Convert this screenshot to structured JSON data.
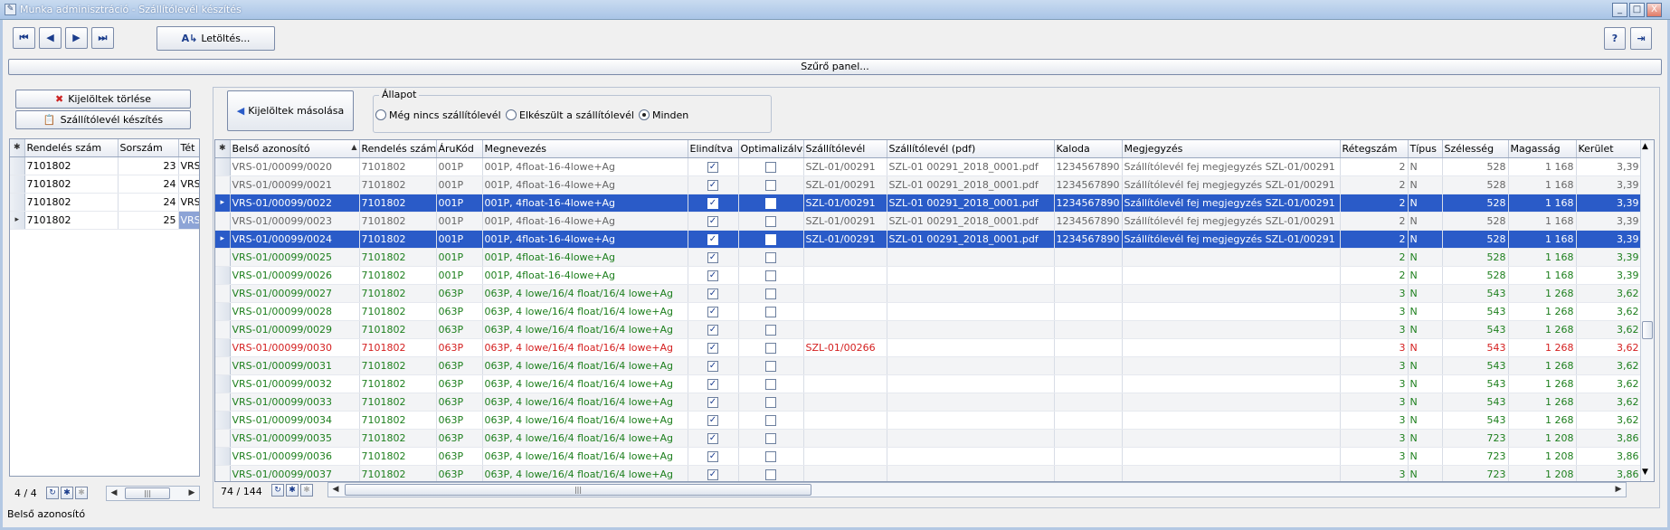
{
  "window": {
    "title": "Munka adminisztráció - Szállítólevél készítés",
    "minimize": "_",
    "maximize": "□",
    "close": "X"
  },
  "toolbar": {
    "first": "⏮",
    "prev": "◀",
    "next": "▶",
    "last": "⏭",
    "download_label": "Letöltés...",
    "download_icon": "A↳",
    "help": "?",
    "exit": "⇥"
  },
  "filter_label": "Szűrő panel...",
  "left": {
    "delete_selected": "Kijelöltek törlése",
    "make_delivery_note": "Szállítólevél készítés",
    "columns": [
      "Rendelés szám",
      "Sorszám",
      "Tét"
    ],
    "rows": [
      {
        "order": "7101802",
        "seq": "23",
        "item": "VRS"
      },
      {
        "order": "7101802",
        "seq": "24",
        "item": "VRS"
      },
      {
        "order": "7101802",
        "seq": "24",
        "item": "VRS"
      },
      {
        "order": "7101802",
        "seq": "25",
        "item": "VRS"
      }
    ],
    "pager": "4 / 4"
  },
  "right": {
    "copy_selected": "Kijelöltek másolása",
    "state": {
      "legend": "Állapot",
      "options": [
        "Még nincs szállítólevél",
        "Elkészült a szállítólevél",
        "Minden"
      ],
      "selected": "Minden"
    },
    "columns": [
      "Belső azonosító",
      "Rendelés szám",
      "ÁruKód",
      "Megnevezés",
      "Elindítva",
      "Optimalizálva",
      "Szállítólevél",
      "Szállítólevél (pdf)",
      "Kaloda",
      "Megjegyzés",
      "Rétegszám",
      "Típus",
      "Szélesség",
      "Magasság",
      "Kerület"
    ],
    "rows": [
      {
        "id": "VRS-01/00099/0020",
        "order": "7101802",
        "code": "001P",
        "name": "001P, 4float-16-4lowe+Ag",
        "started": true,
        "optimized": false,
        "note_no": "SZL-01/00291",
        "pdf": "SZL-01 00291_2018_0001.pdf",
        "crate": "1234567890",
        "comment": "Szállítólevél fej megjegyzés SZL-01/00291",
        "layers": "2",
        "type": "N",
        "width": "528",
        "height": "1 168",
        "perimeter": "3,39",
        "style": "gray"
      },
      {
        "id": "VRS-01/00099/0021",
        "order": "7101802",
        "code": "001P",
        "name": "001P, 4float-16-4lowe+Ag",
        "started": true,
        "optimized": false,
        "note_no": "SZL-01/00291",
        "pdf": "SZL-01 00291_2018_0001.pdf",
        "crate": "1234567890",
        "comment": "Szállítólevél fej megjegyzés SZL-01/00291",
        "layers": "2",
        "type": "N",
        "width": "528",
        "height": "1 168",
        "perimeter": "3,39",
        "style": "gray"
      },
      {
        "id": "VRS-01/00099/0022",
        "order": "7101802",
        "code": "001P",
        "name": "001P, 4float-16-4lowe+Ag",
        "started": true,
        "optimized": false,
        "note_no": "SZL-01/00291",
        "pdf": "SZL-01 00291_2018_0001.pdf",
        "crate": "1234567890",
        "comment": "Szállítólevél fej megjegyzés SZL-01/00291",
        "layers": "2",
        "type": "N",
        "width": "528",
        "height": "1 168",
        "perimeter": "3,39",
        "style": "sel"
      },
      {
        "id": "VRS-01/00099/0023",
        "order": "7101802",
        "code": "001P",
        "name": "001P, 4float-16-4lowe+Ag",
        "started": true,
        "optimized": false,
        "note_no": "SZL-01/00291",
        "pdf": "SZL-01 00291_2018_0001.pdf",
        "crate": "1234567890",
        "comment": "Szállítólevél fej megjegyzés SZL-01/00291",
        "layers": "2",
        "type": "N",
        "width": "528",
        "height": "1 168",
        "perimeter": "3,39",
        "style": "gray"
      },
      {
        "id": "VRS-01/00099/0024",
        "order": "7101802",
        "code": "001P",
        "name": "001P, 4float-16-4lowe+Ag",
        "started": true,
        "optimized": false,
        "note_no": "SZL-01/00291",
        "pdf": "SZL-01 00291_2018_0001.pdf",
        "crate": "1234567890",
        "comment": "Szállítólevél fej megjegyzés SZL-01/00291",
        "layers": "2",
        "type": "N",
        "width": "528",
        "height": "1 168",
        "perimeter": "3,39",
        "style": "sel"
      },
      {
        "id": "VRS-01/00099/0025",
        "order": "7101802",
        "code": "001P",
        "name": "001P, 4float-16-4lowe+Ag",
        "started": true,
        "optimized": false,
        "note_no": "",
        "pdf": "",
        "crate": "",
        "comment": "",
        "layers": "2",
        "type": "N",
        "width": "528",
        "height": "1 168",
        "perimeter": "3,39",
        "style": "green"
      },
      {
        "id": "VRS-01/00099/0026",
        "order": "7101802",
        "code": "001P",
        "name": "001P, 4float-16-4lowe+Ag",
        "started": true,
        "optimized": false,
        "note_no": "",
        "pdf": "",
        "crate": "",
        "comment": "",
        "layers": "2",
        "type": "N",
        "width": "528",
        "height": "1 168",
        "perimeter": "3,39",
        "style": "green"
      },
      {
        "id": "VRS-01/00099/0027",
        "order": "7101802",
        "code": "063P",
        "name": "063P, 4 lowe/16/4 float/16/4 lowe+Ag",
        "started": true,
        "optimized": false,
        "note_no": "",
        "pdf": "",
        "crate": "",
        "comment": "",
        "layers": "3",
        "type": "N",
        "width": "543",
        "height": "1 268",
        "perimeter": "3,62",
        "style": "green"
      },
      {
        "id": "VRS-01/00099/0028",
        "order": "7101802",
        "code": "063P",
        "name": "063P, 4 lowe/16/4 float/16/4 lowe+Ag",
        "started": true,
        "optimized": false,
        "note_no": "",
        "pdf": "",
        "crate": "",
        "comment": "",
        "layers": "3",
        "type": "N",
        "width": "543",
        "height": "1 268",
        "perimeter": "3,62",
        "style": "green"
      },
      {
        "id": "VRS-01/00099/0029",
        "order": "7101802",
        "code": "063P",
        "name": "063P, 4 lowe/16/4 float/16/4 lowe+Ag",
        "started": true,
        "optimized": false,
        "note_no": "",
        "pdf": "",
        "crate": "",
        "comment": "",
        "layers": "3",
        "type": "N",
        "width": "543",
        "height": "1 268",
        "perimeter": "3,62",
        "style": "green"
      },
      {
        "id": "VRS-01/00099/0030",
        "order": "7101802",
        "code": "063P",
        "name": "063P, 4 lowe/16/4 float/16/4 lowe+Ag",
        "started": true,
        "optimized": false,
        "note_no": "SZL-01/00266",
        "pdf": "",
        "crate": "",
        "comment": "",
        "layers": "3",
        "type": "N",
        "width": "543",
        "height": "1 268",
        "perimeter": "3,62",
        "style": "redr"
      },
      {
        "id": "VRS-01/00099/0031",
        "order": "7101802",
        "code": "063P",
        "name": "063P, 4 lowe/16/4 float/16/4 lowe+Ag",
        "started": true,
        "optimized": false,
        "note_no": "",
        "pdf": "",
        "crate": "",
        "comment": "",
        "layers": "3",
        "type": "N",
        "width": "543",
        "height": "1 268",
        "perimeter": "3,62",
        "style": "green"
      },
      {
        "id": "VRS-01/00099/0032",
        "order": "7101802",
        "code": "063P",
        "name": "063P, 4 lowe/16/4 float/16/4 lowe+Ag",
        "started": true,
        "optimized": false,
        "note_no": "",
        "pdf": "",
        "crate": "",
        "comment": "",
        "layers": "3",
        "type": "N",
        "width": "543",
        "height": "1 268",
        "perimeter": "3,62",
        "style": "green"
      },
      {
        "id": "VRS-01/00099/0033",
        "order": "7101802",
        "code": "063P",
        "name": "063P, 4 lowe/16/4 float/16/4 lowe+Ag",
        "started": true,
        "optimized": false,
        "note_no": "",
        "pdf": "",
        "crate": "",
        "comment": "",
        "layers": "3",
        "type": "N",
        "width": "543",
        "height": "1 268",
        "perimeter": "3,62",
        "style": "green"
      },
      {
        "id": "VRS-01/00099/0034",
        "order": "7101802",
        "code": "063P",
        "name": "063P, 4 lowe/16/4 float/16/4 lowe+Ag",
        "started": true,
        "optimized": false,
        "note_no": "",
        "pdf": "",
        "crate": "",
        "comment": "",
        "layers": "3",
        "type": "N",
        "width": "543",
        "height": "1 268",
        "perimeter": "3,62",
        "style": "green"
      },
      {
        "id": "VRS-01/00099/0035",
        "order": "7101802",
        "code": "063P",
        "name": "063P, 4 lowe/16/4 float/16/4 lowe+Ag",
        "started": true,
        "optimized": false,
        "note_no": "",
        "pdf": "",
        "crate": "",
        "comment": "",
        "layers": "3",
        "type": "N",
        "width": "723",
        "height": "1 208",
        "perimeter": "3,86",
        "style": "green"
      },
      {
        "id": "VRS-01/00099/0036",
        "order": "7101802",
        "code": "063P",
        "name": "063P, 4 lowe/16/4 float/16/4 lowe+Ag",
        "started": true,
        "optimized": false,
        "note_no": "",
        "pdf": "",
        "crate": "",
        "comment": "",
        "layers": "3",
        "type": "N",
        "width": "723",
        "height": "1 208",
        "perimeter": "3,86",
        "style": "green"
      },
      {
        "id": "VRS-01/00099/0037",
        "order": "7101802",
        "code": "063P",
        "name": "063P, 4 lowe/16/4 float/16/4 lowe+Ag",
        "started": true,
        "optimized": false,
        "note_no": "",
        "pdf": "",
        "crate": "",
        "comment": "",
        "layers": "3",
        "type": "N",
        "width": "723",
        "height": "1 208",
        "perimeter": "3,86",
        "style": "green"
      }
    ],
    "pager": "74 / 144"
  },
  "status": "Belső azonosító"
}
